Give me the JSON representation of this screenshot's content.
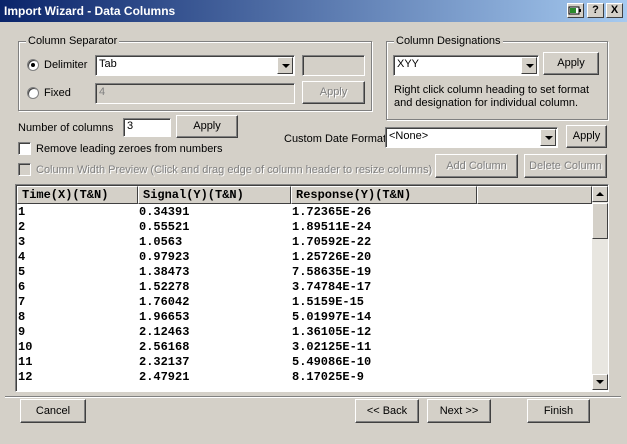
{
  "window": {
    "title": "Import Wizard - Data Columns",
    "help_label": "?",
    "close_label": "X"
  },
  "separator": {
    "group_label": "Column Separator",
    "delimiter_label": "Delimiter",
    "delimiter_value": "Tab",
    "fixed_label": "Fixed",
    "fixed_value": "4",
    "apply_label": "Apply"
  },
  "designations": {
    "group_label": "Column Designations",
    "value": "XYY",
    "apply_label": "Apply",
    "help_text_1": "Right click column heading to set format",
    "help_text_2": "and designation for individual column."
  },
  "columns": {
    "number_label": "Number of columns",
    "number_value": "3",
    "apply_label": "Apply",
    "remove_zeroes_label": "Remove leading zeroes from numbers",
    "preview_label": "Column Width Preview (Click and drag edge of column header to resize columns)"
  },
  "date_format": {
    "label": "Custom Date Format",
    "value": "<None>",
    "apply_label": "Apply"
  },
  "column_buttons": {
    "add_label": "Add Column",
    "delete_label": "Delete Column"
  },
  "grid": {
    "headers": [
      "Time(X)(T&N)",
      "Signal(Y)(T&N)",
      "Response(Y)(T&N)"
    ],
    "rows": [
      [
        "1",
        "0.34391",
        "1.72365E-26"
      ],
      [
        "2",
        "0.55521",
        "1.89511E-24"
      ],
      [
        "3",
        "1.0563",
        "1.70592E-22"
      ],
      [
        "4",
        "0.97923",
        "1.25726E-20"
      ],
      [
        "5",
        "1.38473",
        "7.58635E-19"
      ],
      [
        "6",
        "1.52278",
        "3.74784E-17"
      ],
      [
        "7",
        "1.76042",
        "1.5159E-15"
      ],
      [
        "8",
        "1.96653",
        "5.01997E-14"
      ],
      [
        "9",
        "2.12463",
        "1.36105E-12"
      ],
      [
        "10",
        "2.56168",
        "3.02125E-11"
      ],
      [
        "11",
        "2.32137",
        "5.49086E-10"
      ],
      [
        "12",
        "2.47921",
        "8.17025E-9"
      ]
    ]
  },
  "footer": {
    "cancel_label": "Cancel",
    "back_label": "<< Back",
    "next_label": "Next >>",
    "finish_label": "Finish"
  }
}
